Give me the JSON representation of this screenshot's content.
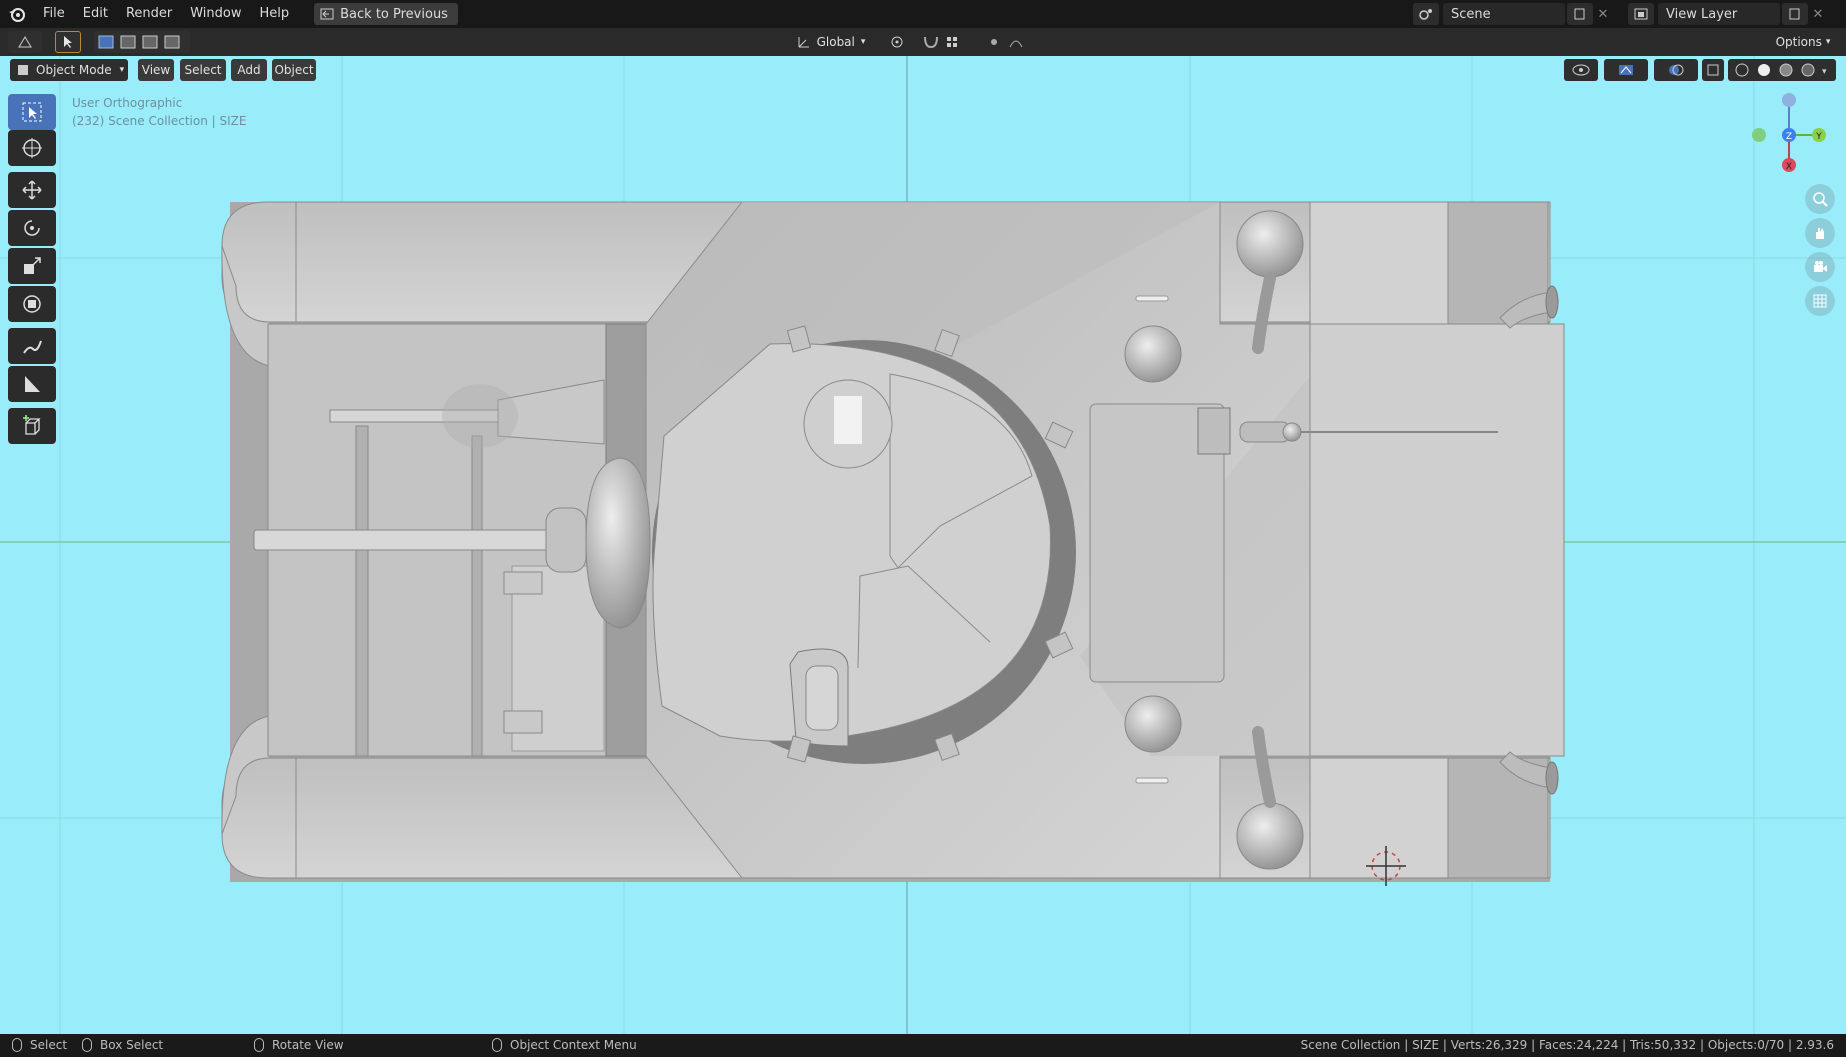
{
  "menu": {
    "items": [
      "File",
      "Edit",
      "Render",
      "Window",
      "Help"
    ],
    "back_button": "Back to Previous"
  },
  "scene": {
    "name": "Scene",
    "view_layer": "View Layer"
  },
  "toolbar": {
    "transform_orientation": "Global",
    "options_label": "Options"
  },
  "viewport_header": {
    "mode": "Object Mode",
    "menus": [
      "View",
      "Select",
      "Add",
      "Object"
    ]
  },
  "viewport": {
    "view_name": "User Orthographic",
    "collection_info": "(232) Scene Collection | SIZE",
    "background_color": "#99edfb",
    "gizmo_axes": [
      "Z",
      "Y",
      "X"
    ]
  },
  "tools": [
    "select-box",
    "cursor",
    "move",
    "rotate",
    "scale",
    "transform",
    "annotate",
    "measure",
    "add-cube"
  ],
  "status": {
    "select": "Select",
    "box_select": "Box Select",
    "rotate_view": "Rotate View",
    "context_menu": "Object Context Menu",
    "stats": "Scene Collection | SIZE | Verts:26,329 | Faces:24,224 | Tris:50,332 | Objects:0/70 | 2.93.6"
  }
}
